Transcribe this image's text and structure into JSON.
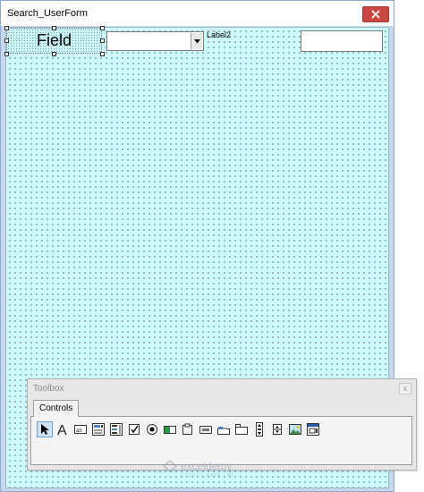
{
  "window": {
    "title": "Search_UserForm"
  },
  "form": {
    "field_label": "Field",
    "combo_value": "",
    "label2": "Label2",
    "textbox_value": ""
  },
  "toolbox": {
    "title": "Toolbox",
    "close_glyph": "x",
    "tab_label": "Controls",
    "tools": [
      {
        "icon": "select-objects-icon"
      },
      {
        "icon": "label-icon"
      },
      {
        "icon": "textbox-icon"
      },
      {
        "icon": "combobox-icon"
      },
      {
        "icon": "listbox-icon"
      },
      {
        "icon": "checkbox-icon"
      },
      {
        "icon": "optionbutton-icon"
      },
      {
        "icon": "togglebutton-icon"
      },
      {
        "icon": "frame-icon"
      },
      {
        "icon": "commandbutton-icon"
      },
      {
        "icon": "tabstrip-icon"
      },
      {
        "icon": "multipage-icon"
      },
      {
        "icon": "scrollbar-icon"
      },
      {
        "icon": "spinbutton-icon"
      },
      {
        "icon": "image-icon"
      },
      {
        "icon": "refedit-icon"
      }
    ]
  },
  "watermark": {
    "brand": "exceldemy",
    "tagline": "EXCEL · DATA · BI"
  },
  "colors": {
    "form_background": "#ccfcff",
    "close_button": "#c9483f",
    "frame": "#c7d8ec"
  }
}
